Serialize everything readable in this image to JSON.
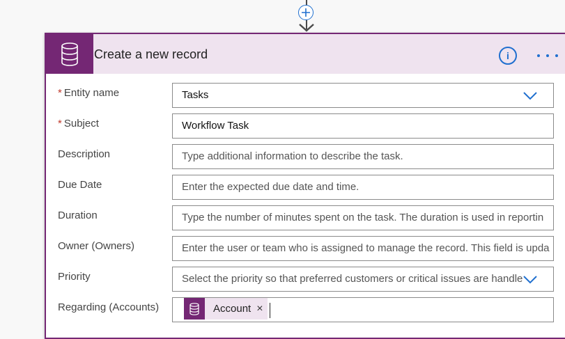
{
  "flow": {
    "add_step_icon": "plus-icon",
    "arrow_icon": "arrow-down-icon"
  },
  "action": {
    "title": "Create a new record",
    "icon": "database-icon",
    "info_icon": "info-icon",
    "info_glyph": "i",
    "menu_icon": "more-options-icon",
    "accent_color": "#742774",
    "header_bg": "#efe3ef"
  },
  "fields": [
    {
      "label": "Entity name",
      "required": true,
      "value": "Tasks",
      "type": "select"
    },
    {
      "label": "Subject",
      "required": true,
      "value": "Workflow Task",
      "type": "text"
    },
    {
      "label": "Description",
      "required": false,
      "placeholder": "Type additional information to describe the task.",
      "type": "text"
    },
    {
      "label": "Due Date",
      "required": false,
      "placeholder": "Enter the expected due date and time.",
      "type": "text"
    },
    {
      "label": "Duration",
      "required": false,
      "placeholder": "Type the number of minutes spent on the task. The duration is used in reportin",
      "type": "text"
    },
    {
      "label": "Owner (Owners)",
      "required": false,
      "placeholder": "Enter the user or team who is assigned to manage the record. This field is upda",
      "type": "text"
    },
    {
      "label": "Priority",
      "required": false,
      "placeholder": "Select the priority so that preferred customers or critical issues are handlе",
      "type": "select"
    },
    {
      "label": "Regarding (Accounts)",
      "required": false,
      "type": "token"
    }
  ],
  "required_marker": "*",
  "regarding_token": {
    "label": "Account",
    "remove": "×",
    "icon": "database-icon"
  }
}
